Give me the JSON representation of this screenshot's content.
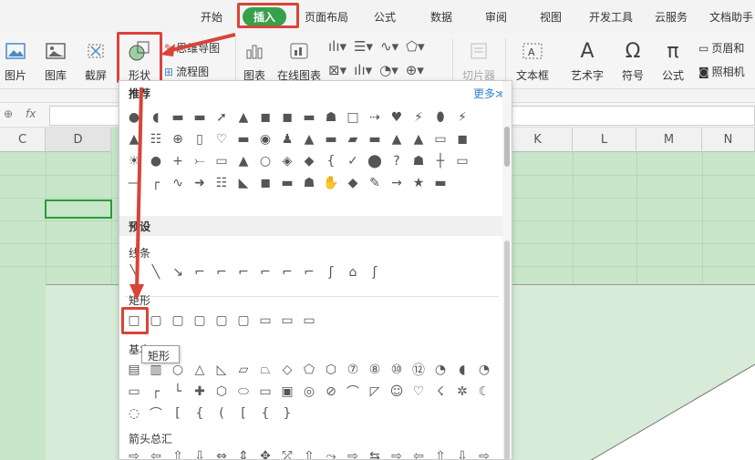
{
  "tabs": [
    "开始",
    "插入",
    "页面布局",
    "公式",
    "数据",
    "审阅",
    "视图",
    "开发工具",
    "云服务",
    "文档助手"
  ],
  "active_tab": "插入",
  "ribbon": {
    "picture": "图片",
    "gallery": "图库",
    "screenshot": "截屏",
    "shape": "形状",
    "mindmap": "思维导图",
    "flowchart": "流程图",
    "chart": "图表",
    "online_chart": "在线图表",
    "slicer": "切片器",
    "textbox": "文本框",
    "wordart": "艺术字",
    "symbol": "符号",
    "formula": "公式",
    "header_footer": "页眉和",
    "camera": "照相机"
  },
  "formula_bar": {
    "fx": "fx"
  },
  "columns": [
    "C",
    "D",
    "K",
    "L",
    "M",
    "N"
  ],
  "panel": {
    "recommended": "推荐",
    "more": "更多",
    "preset": "预设",
    "lines": "线条",
    "rect": "矩形",
    "tooltip": "矩形",
    "basic": "基本",
    "arrows": "箭头总汇"
  }
}
